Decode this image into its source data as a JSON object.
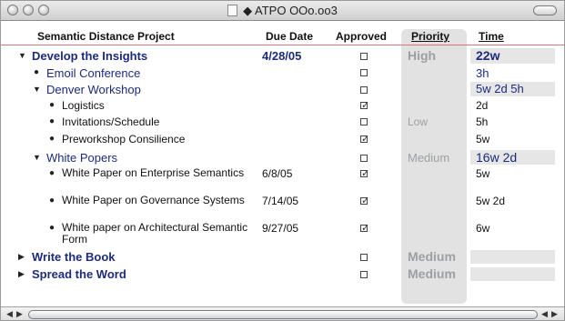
{
  "window": {
    "title": "◆ ATPO OOo.oo3"
  },
  "columns": {
    "topic": "Semantic Distance Project",
    "due": "Due Date",
    "approved": "Approved",
    "priority": "Priority",
    "time": "Time"
  },
  "rows": [
    {
      "title": "Develop the Insights",
      "due": "4/28/05",
      "approved": false,
      "priority": "High",
      "time": "22w"
    },
    {
      "title": "Emoil Conference",
      "due": "",
      "approved": false,
      "priority": "",
      "time": "3h"
    },
    {
      "title": "Denver Workshop",
      "due": "",
      "approved": false,
      "priority": "",
      "time": "5w 2d 5h"
    },
    {
      "title": "Logistics",
      "due": "",
      "approved": true,
      "priority": "",
      "time": "2d"
    },
    {
      "title": "Invitations/Schedule",
      "due": "",
      "approved": false,
      "priority": "Low",
      "time": "5h"
    },
    {
      "title": "Preworkshop Consilience",
      "due": "",
      "approved": true,
      "priority": "",
      "time": "5w"
    },
    {
      "title": "White Popers",
      "due": "",
      "approved": false,
      "priority": "Medium",
      "time": "16w 2d"
    },
    {
      "title": "White Paper on Enterprise Semantics",
      "due": "6/8/05",
      "approved": true,
      "priority": "",
      "time": "5w"
    },
    {
      "title": "White Paper on Governance Systems",
      "due": "7/14/05",
      "approved": true,
      "priority": "",
      "time": "5w 2d"
    },
    {
      "title": "White paper on Architectural Semantic Form",
      "due": "9/27/05",
      "approved": true,
      "priority": "",
      "time": "6w"
    },
    {
      "title": "Write the Book",
      "due": "",
      "approved": false,
      "priority": "Medium",
      "time": ""
    },
    {
      "title": "Spread the Word",
      "due": "",
      "approved": false,
      "priority": "Medium",
      "time": ""
    }
  ],
  "colors": {
    "topic_blue": "#1d2b7a",
    "priority_gray": "#9da0a3",
    "divider_red": "#dd7777"
  }
}
